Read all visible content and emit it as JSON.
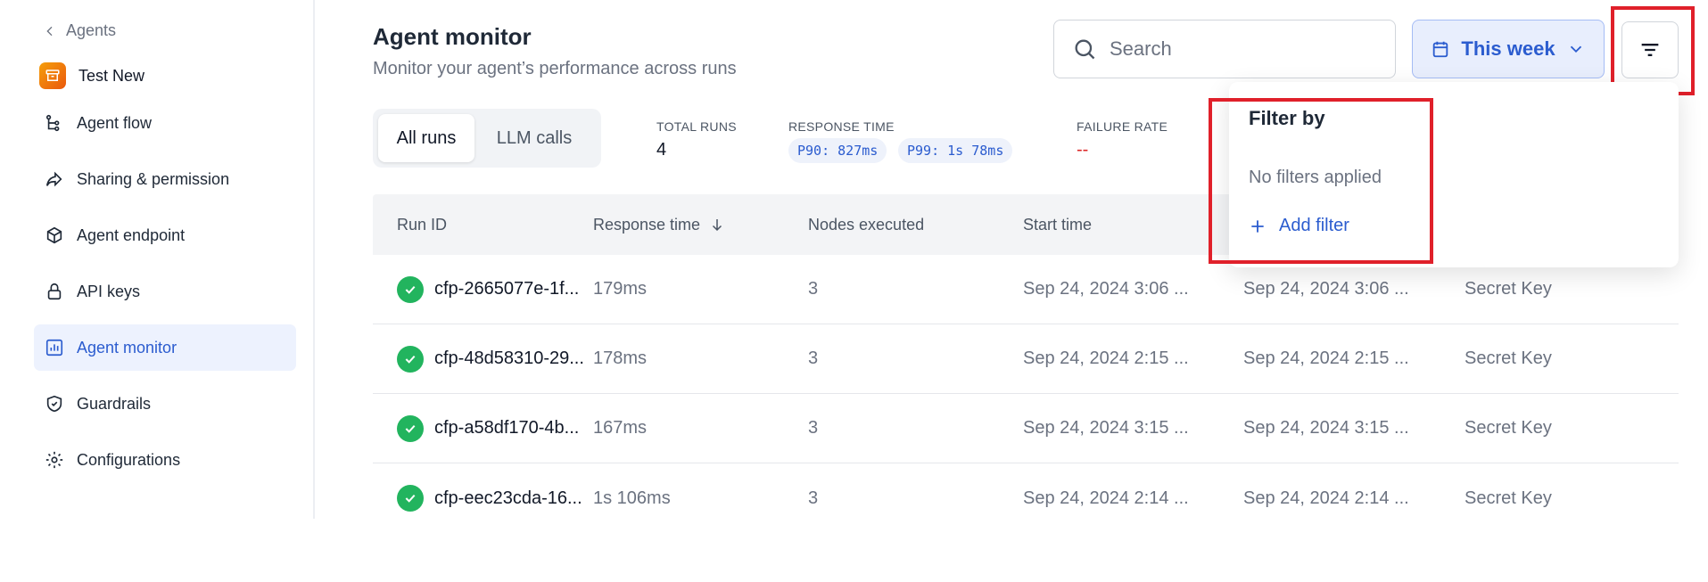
{
  "sidebar": {
    "back_label": "Agents",
    "agent_name": "Test New",
    "items": [
      {
        "label": "Agent flow",
        "icon": "flow-icon"
      },
      {
        "label": "Sharing & permission",
        "icon": "share-icon"
      },
      {
        "label": "Agent endpoint",
        "icon": "cube-icon"
      },
      {
        "label": "API keys",
        "icon": "lock-icon"
      },
      {
        "label": "Agent monitor",
        "icon": "chart-icon",
        "active": true
      },
      {
        "label": "Guardrails",
        "icon": "shield-icon"
      },
      {
        "label": "Configurations",
        "icon": "gear-icon"
      }
    ]
  },
  "header": {
    "title": "Agent monitor",
    "subtitle": "Monitor your agent’s performance across runs"
  },
  "search": {
    "placeholder": "Search"
  },
  "date_range": {
    "label": "This week"
  },
  "tabs": {
    "all_runs": "All runs",
    "llm_calls": "LLM calls"
  },
  "stats": {
    "total_runs_label": "TOTAL RUNS",
    "total_runs_value": "4",
    "response_time_label": "RESPONSE TIME",
    "p90": "P90: 827ms",
    "p99": "P99: 1s 78ms",
    "failure_rate_label": "FAILURE RATE",
    "failure_rate_value": "--"
  },
  "table": {
    "headers": {
      "run_id": "Run ID",
      "response_time": "Response time",
      "nodes_executed": "Nodes executed",
      "start_time": "Start time"
    },
    "rows": [
      {
        "run_id": "cfp-2665077e-1f...",
        "response_time": "179ms",
        "nodes": "3",
        "start": "Sep 24, 2024 3:06 ...",
        "end": "Sep 24, 2024 3:06 ...",
        "source": "Secret Key"
      },
      {
        "run_id": "cfp-48d58310-29...",
        "response_time": "178ms",
        "nodes": "3",
        "start": "Sep 24, 2024 2:15 ...",
        "end": "Sep 24, 2024 2:15 ...",
        "source": "Secret Key"
      },
      {
        "run_id": "cfp-a58df170-4b...",
        "response_time": "167ms",
        "nodes": "3",
        "start": "Sep 24, 2024 3:15 ...",
        "end": "Sep 24, 2024 3:15 ...",
        "source": "Secret Key"
      },
      {
        "run_id": "cfp-eec23cda-16...",
        "response_time": "1s 106ms",
        "nodes": "3",
        "start": "Sep 24, 2024 2:14 ...",
        "end": "Sep 24, 2024 2:14 ...",
        "source": "Secret Key"
      }
    ]
  },
  "filter_dropdown": {
    "title": "Filter by",
    "empty_text": "No filters applied",
    "add_label": "Add filter"
  },
  "colors": {
    "accent": "#2b5ccf",
    "success": "#22b45e",
    "highlight": "#e0202a",
    "failure": "#dc2626"
  }
}
